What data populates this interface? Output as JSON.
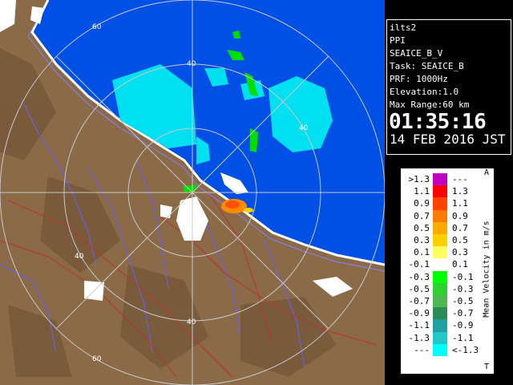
{
  "info": {
    "radar": "ilts2",
    "mode": "PPI",
    "product": "SEAICE_B_V",
    "task": "Task: SEAICE_B",
    "prf": "PRF: 1000Hz",
    "elevation": "Elevation:1.0",
    "max_range": "Max Range:60 km",
    "time": "01:35:16",
    "date": "14 FEB 2016 JST"
  },
  "rings": {
    "labels": [
      "60",
      "40",
      "40",
      "40",
      "40",
      "60"
    ]
  },
  "legend": {
    "title": "Mean Velocity in m/s",
    "top_marker": "A",
    "bottom_marker": "T",
    "rows": [
      {
        "left": ">1.3",
        "right": "---",
        "color": "#c000c0"
      },
      {
        "left": "1.1",
        "right": "1.3",
        "color": "#ff0000"
      },
      {
        "left": "0.9",
        "right": "1.1",
        "color": "#ff4400"
      },
      {
        "left": "0.7",
        "right": "0.9",
        "color": "#ff7a00"
      },
      {
        "left": "0.5",
        "right": "0.7",
        "color": "#ffaa00"
      },
      {
        "left": "0.3",
        "right": "0.5",
        "color": "#ffd000"
      },
      {
        "left": "0.1",
        "right": "0.3",
        "color": "#ffff60"
      },
      {
        "left": "-0.1",
        "right": "0.1",
        "color": "#ffffff"
      },
      {
        "left": "-0.3",
        "right": "-0.1",
        "color": "#00ff00"
      },
      {
        "left": "-0.5",
        "right": "-0.3",
        "color": "#30d030"
      },
      {
        "left": "-0.7",
        "right": "-0.5",
        "color": "#50b850"
      },
      {
        "left": "-0.9",
        "right": "-0.7",
        "color": "#2e8b57"
      },
      {
        "left": "-1.1",
        "right": "-0.9",
        "color": "#20a0a0"
      },
      {
        "left": "-1.3",
        "right": "-1.1",
        "color": "#20c8c8"
      },
      {
        "left": "---",
        "right": "<-1.3",
        "color": "#00ffff"
      }
    ]
  },
  "colors": {
    "sea": "#0050e6",
    "land": "#8b6b47",
    "ring": "#c8c8c8",
    "coast": "#ffffff"
  }
}
